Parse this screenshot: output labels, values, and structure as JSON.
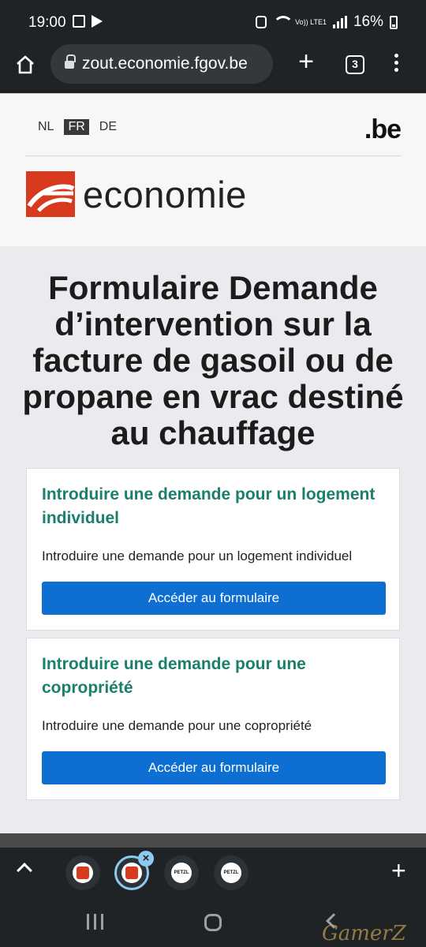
{
  "status_bar": {
    "time": "19:00",
    "battery": "16%",
    "network": "Vo)) LTE1"
  },
  "browser": {
    "url": "zout.economie.fgov.be",
    "tab_count": "3"
  },
  "site_header": {
    "languages": [
      "NL",
      "FR",
      "DE"
    ],
    "active_language": "FR",
    "gov_logo": ".be",
    "brand_word": "economie"
  },
  "page_title": "Formulaire Demande d’intervention sur la facture de gasoil ou de propane en vrac destiné au chauffage",
  "cards": [
    {
      "title": "Introduire une demande pour un logement individuel",
      "description": "Introduire une demande pour un logement individuel",
      "button": "Accéder au formulaire"
    },
    {
      "title": "Introduire une demande pour une copropriété",
      "description": "Introduire une demande pour une copropriété",
      "button": "Accéder au formulaire"
    }
  ],
  "tab_strip": {
    "petzl_label": "PETZL"
  },
  "watermark": "GamerZ",
  "colors": {
    "accent_green": "#1a7f6b",
    "button_blue": "#0d6fd1",
    "brand_red": "#d73a1d"
  }
}
